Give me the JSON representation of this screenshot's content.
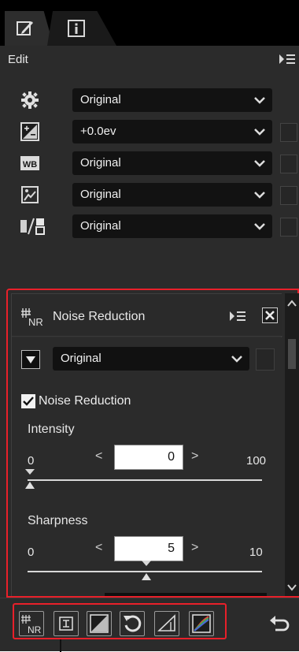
{
  "tabs": [
    {
      "name": "edit",
      "icon": "edit-icon"
    },
    {
      "name": "info",
      "icon": "info-icon"
    }
  ],
  "edit_panel": {
    "title": "Edit",
    "rows": [
      {
        "icon": "gear-icon",
        "value": "Original",
        "has_checkbox": false
      },
      {
        "icon": "exposure-compensation-icon",
        "value": "+0.0ev",
        "has_checkbox": true
      },
      {
        "icon": "white-balance-icon",
        "icon_text": "WB",
        "value": "Original",
        "has_checkbox": true
      },
      {
        "icon": "picture-control-icon",
        "value": "Original",
        "has_checkbox": true
      },
      {
        "icon": "active-d-lighting-icon",
        "value": "Original",
        "has_checkbox": true
      }
    ]
  },
  "noise_reduction": {
    "title": "Noise Reduction",
    "icon_text": "NR",
    "preset": "Original",
    "checkbox_label": "Noise Reduction",
    "checked": true,
    "intensity": {
      "label": "Intensity",
      "min": "0",
      "max": "100",
      "value": "0"
    },
    "sharpness": {
      "label": "Sharpness",
      "min": "0",
      "max": "10",
      "value": "5"
    }
  },
  "toolbar": {
    "buttons": [
      "noise-reduction-tool",
      "straighten-tool",
      "levels-curves-tool",
      "rotate-tool",
      "perspective-tool",
      "color-tool"
    ],
    "nr_text": "NR"
  },
  "colors": {
    "highlight": "#e8202a",
    "panel": "#2b2b2b",
    "dropdown": "#121212"
  }
}
